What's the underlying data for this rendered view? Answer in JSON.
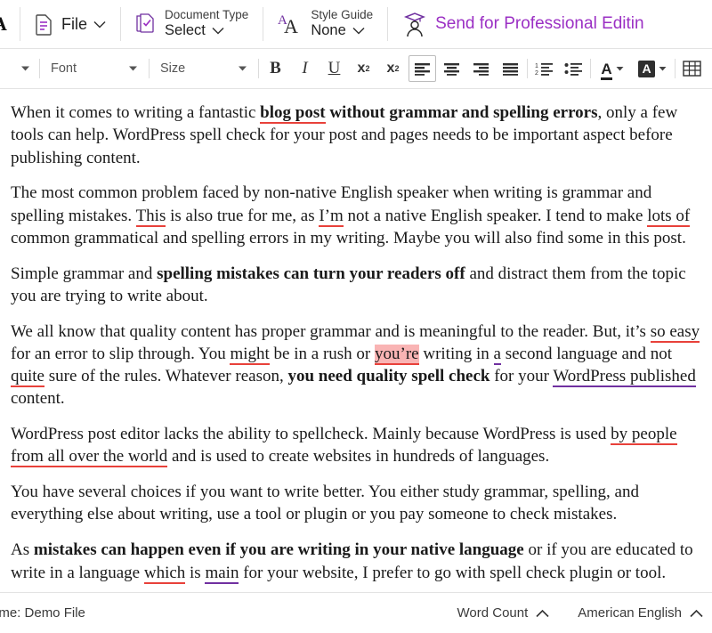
{
  "topbar": {
    "logo_letter": "A",
    "file_menu": {
      "label": "File",
      "icon": "document-lines-icon"
    },
    "document_type": {
      "top_label": "Document Type",
      "value": "Select",
      "icon": "document-check-icon"
    },
    "style_guide": {
      "top_label": "Style Guide",
      "value": "None",
      "icon": "double-a-icon"
    },
    "send_professional": {
      "label": "Send for Professional Editin",
      "icon": "graduate-person-icon",
      "color": "#9b30c4"
    }
  },
  "formatbar": {
    "font_dropdown": {
      "label": "Font"
    },
    "size_dropdown": {
      "label": "Size"
    },
    "bold": "B",
    "italic": "I",
    "underline": "U",
    "subscript": "x",
    "subscript_sub": "2",
    "superscript": "x",
    "superscript_sup": "2",
    "color_letter": "A",
    "highlight_letter": "A"
  },
  "document": {
    "paragraphs": [
      {
        "id": "p1",
        "runs": [
          {
            "text": "When it comes to writing a fantastic ",
            "style": "normal"
          },
          {
            "text": "blog post",
            "style": "bold-underline-red"
          },
          {
            "text": " without grammar and spelling errors",
            "style": "bold"
          },
          {
            "text": ", only a few tools can help. WordPress spell check for your post and pages needs to be important aspect before publishing content.",
            "style": "normal"
          }
        ]
      },
      {
        "id": "p2",
        "runs": [
          {
            "text": "The most common problem faced by non-native English speaker when writing is grammar and spelling mistakes. ",
            "style": "normal"
          },
          {
            "text": "This",
            "style": "underline-red"
          },
          {
            "text": " is also true for me, as ",
            "style": "normal"
          },
          {
            "text": "I’m",
            "style": "underline-red"
          },
          {
            "text": " not a native English speaker. I tend to make ",
            "style": "normal"
          },
          {
            "text": "lots of",
            "style": "underline-red"
          },
          {
            "text": " common grammatical and spelling errors in my writing. Maybe you will also find some in this post.",
            "style": "normal"
          }
        ]
      },
      {
        "id": "p3",
        "runs": [
          {
            "text": "Simple grammar and ",
            "style": "normal"
          },
          {
            "text": "spelling mistakes can turn your readers off",
            "style": "bold"
          },
          {
            "text": " and distract them from the topic you are trying to write about.",
            "style": "normal"
          }
        ]
      },
      {
        "id": "p4",
        "runs": [
          {
            "text": "We all know that quality content has proper grammar and is meaningful to the reader. But, it’s ",
            "style": "normal"
          },
          {
            "text": "so easy",
            "style": "underline-red"
          },
          {
            "text": " for an error to slip through. You ",
            "style": "normal"
          },
          {
            "text": "might",
            "style": "underline-red"
          },
          {
            "text": " be in a rush or ",
            "style": "normal"
          },
          {
            "text": "you’re",
            "style": "highlight-pink-underline-red"
          },
          {
            "text": " writing in ",
            "style": "normal"
          },
          {
            "text": "a",
            "style": "underline-purple"
          },
          {
            "text": " second language and not ",
            "style": "normal"
          },
          {
            "text": "quite",
            "style": "underline-red"
          },
          {
            "text": " sure of the rules. Whatever reason, ",
            "style": "normal"
          },
          {
            "text": "you need quality spell check",
            "style": "bold"
          },
          {
            "text": " for your ",
            "style": "normal"
          },
          {
            "text": "WordPress published",
            "style": "underline-purple"
          },
          {
            "text": " content.",
            "style": "normal"
          }
        ]
      },
      {
        "id": "p5",
        "runs": [
          {
            "text": "WordPress post editor lacks the ability to spellcheck. Mainly because WordPress is used ",
            "style": "normal"
          },
          {
            "text": "by people from all over the world",
            "style": "underline-red"
          },
          {
            "text": " and is used to create websites in hundreds of languages.",
            "style": "normal"
          }
        ]
      },
      {
        "id": "p6",
        "runs": [
          {
            "text": "You have several choices if you want to write better. You either study grammar, spelling, and everything else about writing, use a tool or plugin or you pay someone to check mistakes.",
            "style": "normal"
          }
        ]
      },
      {
        "id": "p7",
        "runs": [
          {
            "text": "As ",
            "style": "normal"
          },
          {
            "text": "mistakes can happen even if you are writing in your native language",
            "style": "bold"
          },
          {
            "text": " or if you are educated to write in a language ",
            "style": "normal"
          },
          {
            "text": "which",
            "style": "underline-red"
          },
          {
            "text": " is ",
            "style": "normal"
          },
          {
            "text": "main",
            "style": "underline-purple"
          },
          {
            "text": " for your website, I prefer to go with spell check plugin or tool.",
            "style": "normal"
          }
        ]
      }
    ]
  },
  "statusbar": {
    "filename_label": "ame: Demo File",
    "word_count": "Word Count",
    "language": "American English"
  },
  "colors": {
    "accent_purple": "#9b30c4",
    "underline_red": "#e8413a",
    "underline_purple": "#7030a0",
    "highlight_pink": "#f9b4b4"
  }
}
